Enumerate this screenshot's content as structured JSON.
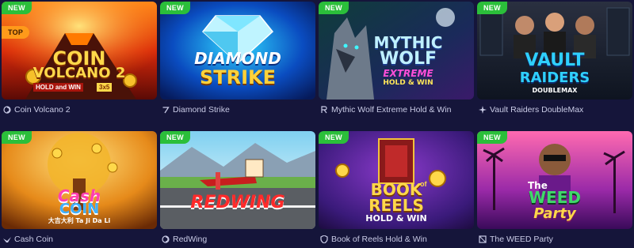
{
  "badges": {
    "new": "NEW",
    "top": "TOP"
  },
  "games": [
    {
      "title": "Coin Volcano 2",
      "art_lines": [
        "COIN",
        "VOLCANO 2",
        "HOLD and WIN",
        "3x5"
      ],
      "provider_icon": "swirl-icon"
    },
    {
      "title": "Diamond Strike",
      "art_lines": [
        "DIAMOND",
        "STRIKE"
      ],
      "provider_icon": "seven-icon"
    },
    {
      "title": "Mythic Wolf Extreme Hold & Win",
      "art_lines": [
        "MYTHIC",
        "WOLF",
        "EXTREME",
        "HOLD & WIN"
      ],
      "provider_icon": "r-letter-icon"
    },
    {
      "title": "Vault Raiders DoubleMax",
      "art_lines": [
        "VAULT",
        "RAIDERS",
        "DOUBLEMAX"
      ],
      "provider_icon": "sparkle-icon"
    },
    {
      "title": "Cash Coin",
      "art_lines": [
        "Cash",
        "COIN",
        "大吉大利 Ta Ji Da Li"
      ],
      "provider_icon": "bird-icon"
    },
    {
      "title": "RedWing",
      "art_lines": [
        "REDWING"
      ],
      "provider_icon": "swirl-icon"
    },
    {
      "title": "Book of Reels Hold & Win",
      "art_lines": [
        "BOOK",
        "of",
        "REELS",
        "HOLD & WIN"
      ],
      "provider_icon": "shield-icon"
    },
    {
      "title": "The WEED Party",
      "art_lines": [
        "The",
        "WEED",
        "Party"
      ],
      "provider_icon": "box-icon"
    }
  ],
  "colors": {
    "background": "#15153a",
    "new_badge": "#2bbf3a",
    "top_badge": "#ff9a1a",
    "caption_text": "#c9cbe6"
  }
}
